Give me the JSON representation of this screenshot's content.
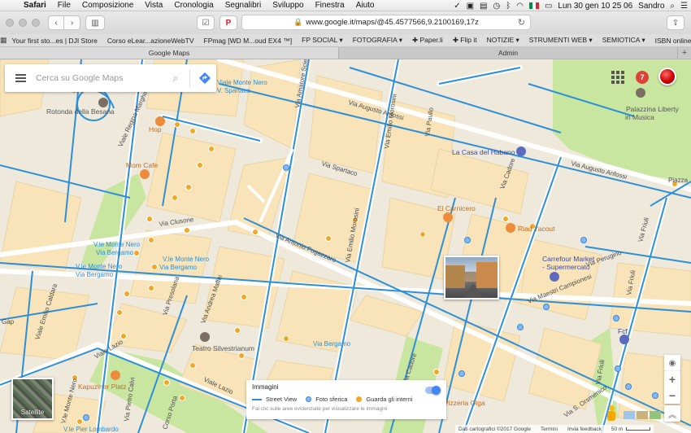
{
  "menubar": {
    "app": "Safari",
    "items": [
      "File",
      "Composizione",
      "Vista",
      "Cronologia",
      "Segnalibri",
      "Sviluppo",
      "Finestra",
      "Aiuto"
    ],
    "clock": "Lun 30 gen  10 25 06",
    "user": "Sandro"
  },
  "toolbar": {
    "url": "www.google.it/maps/@45.4577566,9.2100169,17z"
  },
  "favorites": [
    "Your first sto...es | DJI Store",
    "Corso eLear...azioneWebTV",
    "FPmag [WD M...oud EX4 ™]",
    "FP SOCIAL ▾",
    "FOTOGRAFIA ▾",
    "✚ Paper.li",
    "✚ Flip it",
    "NOTIZIE ▾",
    "STRUMENTI WEB ▾",
    "SEMIOTICA ▾",
    "ISBN online"
  ],
  "tabs": [
    {
      "label": "Google Maps",
      "active": true
    },
    {
      "label": "Admin",
      "active": false
    }
  ],
  "map": {
    "search_placeholder": "Cerca su Google Maps",
    "notification_count": "7",
    "streets": {
      "augusto_anfossi": "Via Augusto Anfossi",
      "augusto_anfossi2": "Via Augusto Anfossi",
      "amatore_sciesa": "Via Amatore Sciesa",
      "monte_nero": "Viale Monte Nero",
      "v_spartaco": "V. Spartaco",
      "regina_margherita": "Viale Regina Margherita",
      "emilio_morosini": "Via Emilio Morosini",
      "emilio_morosini2": "Via Emilio Morosini",
      "spartaco": "Via Spartaco",
      "paullo": "Via Paullo",
      "cadore": "Via Cadore",
      "cadore2": "Via Cadore",
      "clusone": "Via Clusone",
      "antonio_fogazzaro": "Via Antonio Fogazzaro",
      "v_le_monte_nero_bergamo": "V.le Monte Nero",
      "via_bergamo": "Via Bergamo",
      "v_le_monte_nero_bergamo2": "V.le Monte Nero",
      "via_bergamo2": "Via Bergamo",
      "v_le_monte_nero3": "V.le Monte Nero",
      "via_bergamo3": "Via Bergamo",
      "andrea_maffei": "Via Andrea Maffei",
      "presolana": "Via Presolana",
      "pietro_calvi": "Via Pietro Calvi",
      "emilio_caldara": "Viale Emilio Caldara",
      "viale_lazio": "Viale Lazio",
      "viale_lazio2": "Viale Lazio",
      "via_bergamo4": "Via Bergamo",
      "maestri_campionesi": "Via Maestri Campionesi",
      "perugino": "Via Perugino",
      "friuli": "Via Friuli",
      "friuli2": "Via Friuli",
      "friuli3": "Via Friuli",
      "sormenico": "Via S. Orsmenico",
      "piazza": "Piazza",
      "gap": "Gap",
      "crocetta": "Corso Porta",
      "pier_lombardo": "V.le Pier Lombardo",
      "pier_lombardo_vle": "V.le Monte Nero"
    },
    "places": {
      "rotonda": "Rotonda della Besana",
      "hop": "Hop",
      "mom_cafe": "Mom Cafe",
      "palazzina": "Palazzina Liberty",
      "palazzina2": "in Musica",
      "habano": "La Casa del Habano",
      "carnicero": "El Carnicero",
      "riad": "Riad Yacout",
      "carrefour": "Carrefour Market",
      "carrefour2": "- Supermercato",
      "teatro": "Teatro Silvestrianum",
      "kapuziner": "Kapuziner Platz",
      "olga": "Pizzeria Olga",
      "fcf": "Fcf"
    },
    "satellite_label": "Satellite",
    "imagery": {
      "title": "Immagini",
      "street_view": "Street View",
      "photosphere": "Foto sferica",
      "indoor": "Guarda gli interni",
      "note": "Fai clic sulle aree evidenziate per visualizzare le immagini"
    },
    "footer": {
      "data": "Dati cartografici ©2017 Google",
      "terms": "Termini",
      "feedback": "Invia feedback",
      "scale": "50 m"
    }
  },
  "colors": {
    "street_view_line": "#2c8fd8",
    "park": "#c8e6a0",
    "map_bg": "#efe9dc",
    "block": "#f8e4b8"
  }
}
